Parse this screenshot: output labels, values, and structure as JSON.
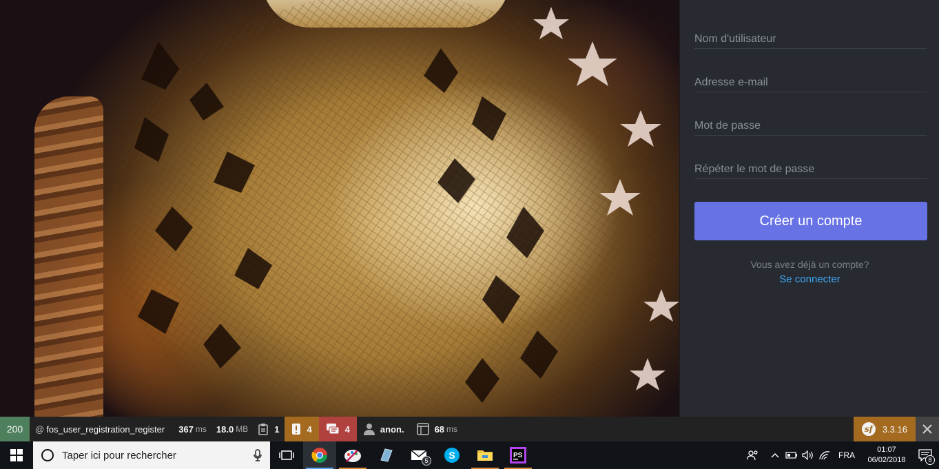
{
  "form": {
    "username_placeholder": "Nom d'utilisateur",
    "email_placeholder": "Adresse e-mail",
    "password_placeholder": "Mot de passe",
    "password_repeat_placeholder": "Répéter le mot de passe",
    "submit_label": "Créer un compte",
    "already_text": "Vous avez déjà un compte?",
    "login_link": "Se connecter",
    "accent_color": "#6772e5",
    "link_color": "#3ea8f4"
  },
  "debug_toolbar": {
    "status_code": "200",
    "route_prefix": "@",
    "route": "fos_user_registration_register",
    "time_value": "367",
    "time_unit": "ms",
    "memory_value": "18.0",
    "memory_unit": "MB",
    "forms_count": "1",
    "warnings_count": "4",
    "errors_count": "4",
    "user": "anon.",
    "twig_time_value": "68",
    "twig_time_unit": "ms",
    "symfony_version": "3.3.16",
    "status_color": "#4f805d",
    "warning_color": "#a46a1f",
    "error_color": "#b0413e"
  },
  "taskbar": {
    "search_placeholder": "Taper ici pour rechercher",
    "apps": [
      "chrome-icon",
      "paint-icon",
      "notepad-icon",
      "mail-icon",
      "skype-icon",
      "file-explorer-icon",
      "phpstorm-icon"
    ],
    "mail_badge": "5",
    "language": "FRA",
    "time": "01:07",
    "date": "06/02/2018",
    "notifications_count": "8"
  }
}
